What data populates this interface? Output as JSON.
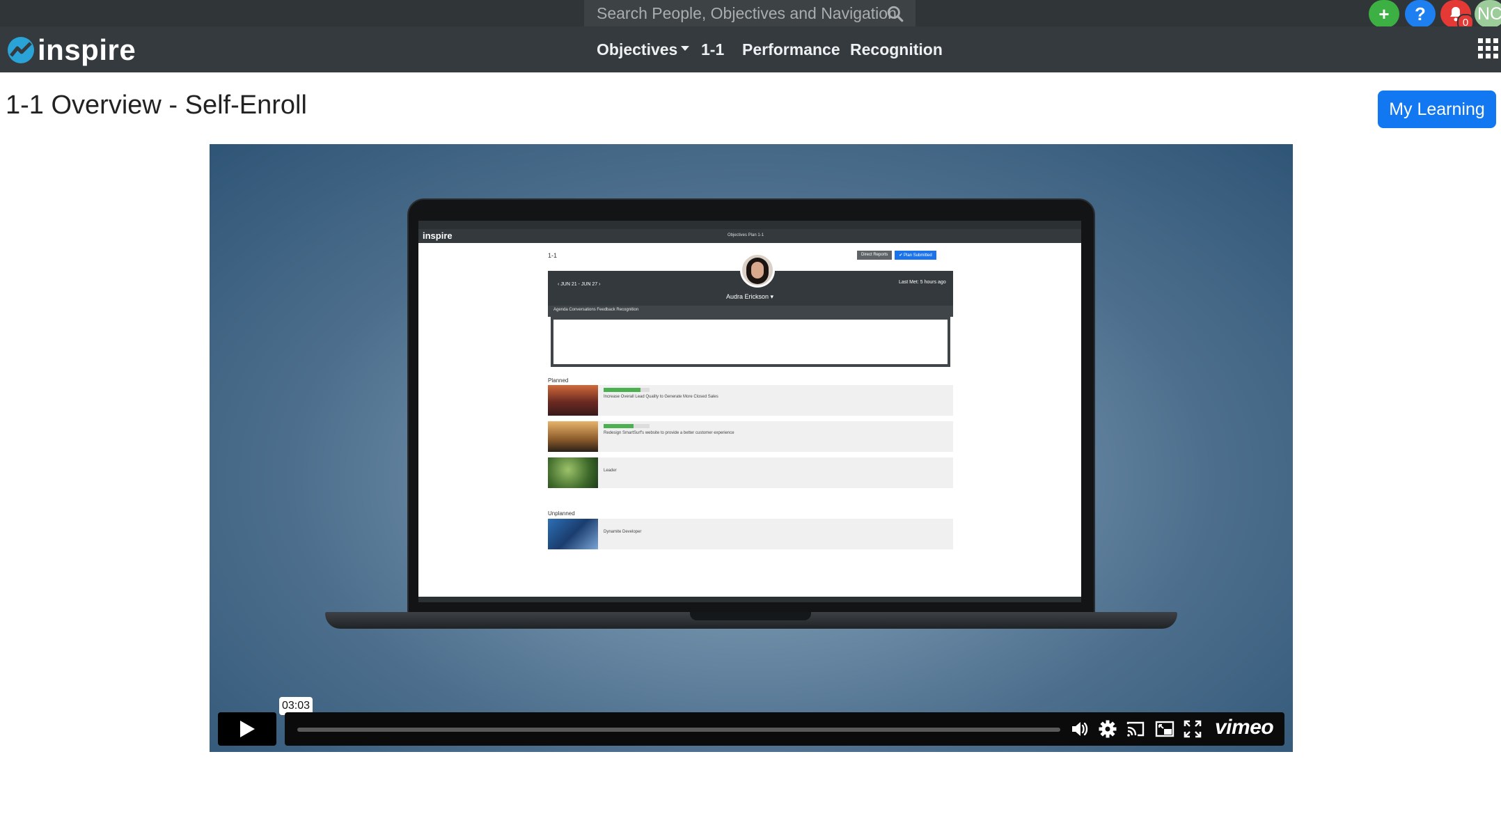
{
  "topbar": {
    "search_placeholder": "Search People, Objectives and Navigation",
    "add_label": "+",
    "help_label": "?",
    "notification_count": "0",
    "user_initials": "NC",
    "colors": {
      "add": "#3cb043",
      "help": "#1e7ff0",
      "bell": "#e53935"
    }
  },
  "navbar": {
    "logo_text": "inspire",
    "items": [
      {
        "label": "Objectives",
        "has_dropdown": true
      },
      {
        "label": "1-1"
      },
      {
        "label": "Performance"
      },
      {
        "label": "Recognition"
      }
    ]
  },
  "page": {
    "title": "1-1 Overview - Self-Enroll",
    "my_learning_label": "My Learning",
    "accent": "#1278f2"
  },
  "video": {
    "tooltip_time": "03:03",
    "brand": "vimeo",
    "screen": {
      "logo": "inspire",
      "nav_text": "Objectives  Plan  1-1",
      "title": "1-1",
      "direct_reports": "Direct Reports",
      "plan_submitted": "✔ Plan Submitted",
      "person_name": "Audra Erickson ▾",
      "week": "‹   JUN 21 - JUN 27   ›",
      "last_met": "Last Met: 5 hours ago",
      "tabs": "Agenda    Conversations    Feedback    Recognition",
      "planned_label": "Planned",
      "unplanned_label": "Unplanned",
      "rows": [
        {
          "title": "Increase Overall Lead Quality to Generate More Closed Sales",
          "progress": 0.8
        },
        {
          "title": "Redesign SmartSurf's website to provide a better customer experience",
          "progress": 0.65
        },
        {
          "title": "Leader",
          "progress": null
        }
      ],
      "unplanned_rows": [
        {
          "title": "Dynamite Developer"
        }
      ]
    }
  }
}
